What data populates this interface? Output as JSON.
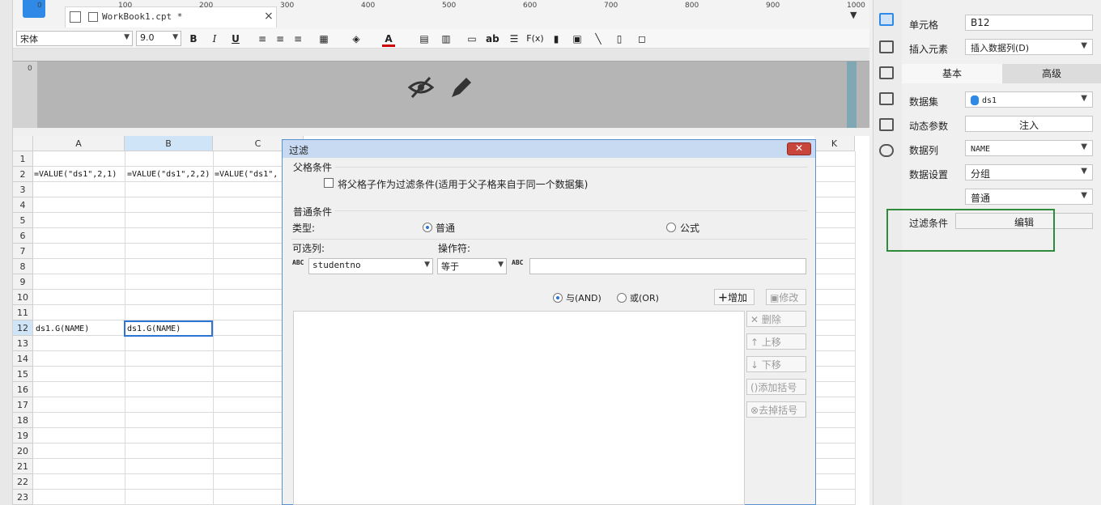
{
  "tab": {
    "title": "WorkBook1.cpt *",
    "close": "×",
    "menu": "▼"
  },
  "toolbar": {
    "font": "宋体",
    "size": "9.0",
    "bold": "B",
    "italic": "I",
    "underline": "U",
    "text_ab": "ab",
    "fx": "F(x)"
  },
  "ruler": [
    "0",
    "100",
    "200",
    "300",
    "400",
    "500",
    "600",
    "700",
    "800",
    "900",
    "1000"
  ],
  "vruler": [
    "0"
  ],
  "sheet": {
    "columns": [
      "A",
      "B",
      "C",
      "K"
    ],
    "rows": [
      "1",
      "2",
      "3",
      "4",
      "5",
      "6",
      "7",
      "8",
      "9",
      "10",
      "11",
      "12",
      "13",
      "14",
      "15",
      "16",
      "17",
      "18",
      "19",
      "20",
      "21",
      "22",
      "23"
    ],
    "a2": "=VALUE(\"ds1\",2,1)",
    "b2": "=VALUE(\"ds1\",2,2)",
    "c2": "=VALUE(\"ds1\",",
    "a12": "ds1.G(NAME)",
    "b12": "ds1.G(NAME)"
  },
  "dialog": {
    "title": "过滤",
    "close": "✕",
    "parent_group": "父格条件",
    "parent_checkbox": "将父格子作为过滤条件(适用于父子格来自于同一个数据集)",
    "normal_group": "普通条件",
    "type_label": "类型:",
    "type_normal": "普通",
    "type_formula": "公式",
    "column_label": "可选列:",
    "operator_label": "操作符:",
    "column_value": "studentno",
    "operator_value": "等于",
    "and_label": "与(AND)",
    "or_label": "或(OR)",
    "add": "增加",
    "modify": "修改",
    "delete": "删除",
    "up": "上移",
    "down": "下移",
    "add_bracket": "添加括号",
    "remove_bracket": "去掉括号"
  },
  "panel": {
    "cell_label": "单元格",
    "cell_value": "B12",
    "insert_label": "插入元素",
    "insert_value": "插入数据列(D)",
    "tab_basic": "基本",
    "tab_advanced": "高级",
    "dataset_label": "数据集",
    "dataset_value": "ds1",
    "dynamic_label": "动态参数",
    "dynamic_button": "注入",
    "column_label": "数据列",
    "column_value": "NAME",
    "setting_label": "数据设置",
    "setting_value": "分组",
    "setting_value2": "普通",
    "filter_label": "过滤条件",
    "filter_button": "编辑"
  },
  "colors": {
    "accent": "#2e8ae6",
    "selection": "#2c74d6",
    "highlight": "#2e8b3c",
    "dialog_title": "#c8daf2"
  }
}
